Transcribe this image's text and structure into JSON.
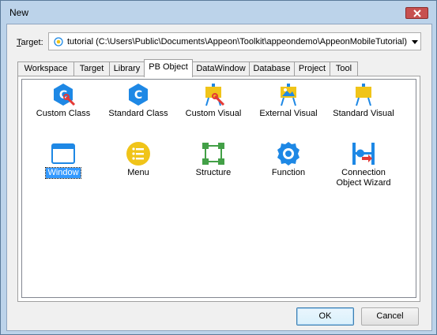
{
  "window": {
    "title": "New"
  },
  "target": {
    "label_prefix": "T",
    "label_rest": "arget:",
    "value": "tutorial (C:\\Users\\Public\\Documents\\Appeon\\Toolkit\\appeondemo\\AppeonMobileTutorial)"
  },
  "tabs": [
    {
      "label": "Workspace"
    },
    {
      "label": "Target"
    },
    {
      "label": "Library"
    },
    {
      "label": "PB Object"
    },
    {
      "label": "DataWindow"
    },
    {
      "label": "Database"
    },
    {
      "label": "Project"
    },
    {
      "label": "Tool"
    }
  ],
  "active_tab": "PB Object",
  "items": [
    {
      "label": "Custom Class",
      "icon": "custom-class-icon"
    },
    {
      "label": "Standard Class",
      "icon": "standard-class-icon"
    },
    {
      "label": "Custom Visual",
      "icon": "custom-visual-icon"
    },
    {
      "label": "External Visual",
      "icon": "external-visual-icon"
    },
    {
      "label": "Standard Visual",
      "icon": "standard-visual-icon"
    },
    {
      "label": "Window",
      "icon": "window-icon",
      "selected": true
    },
    {
      "label": "Menu",
      "icon": "menu-icon"
    },
    {
      "label": "Structure",
      "icon": "structure-icon"
    },
    {
      "label": "Function",
      "icon": "function-icon"
    },
    {
      "label": "Connection Object Wizard",
      "icon": "connection-object-wizard-icon"
    }
  ],
  "buttons": {
    "ok": "OK",
    "cancel": "Cancel"
  },
  "colors": {
    "accent_blue": "#1e88e5",
    "accent_yellow": "#f0c419",
    "selection": "#3399ff",
    "wrench_red": "#e53935",
    "structure_green": "#43a047"
  }
}
